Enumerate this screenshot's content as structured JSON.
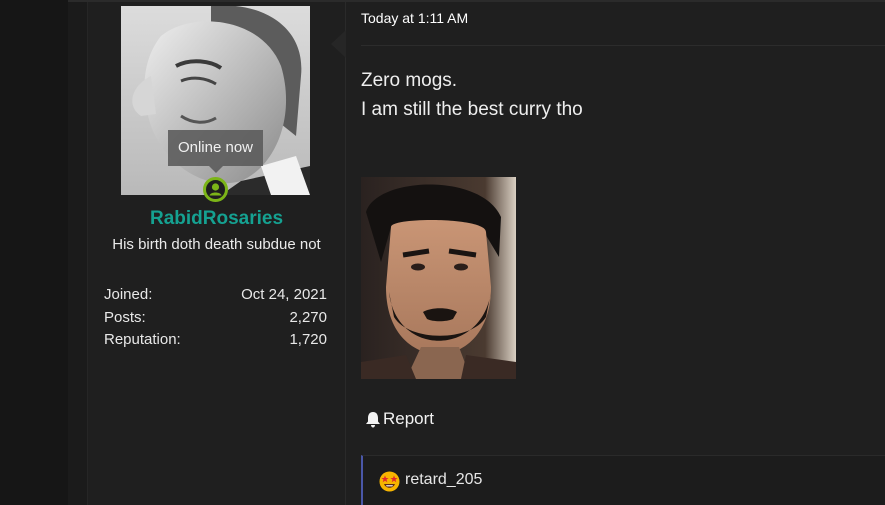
{
  "user": {
    "online_tooltip": "Online now",
    "username": "RabidRosaries",
    "title": "His birth doth death subdue not",
    "stats": [
      {
        "label": "Joined:",
        "value": "Oct 24, 2021"
      },
      {
        "label": "Posts:",
        "value": "2,270"
      },
      {
        "label": "Reputation:",
        "value": "1,720"
      }
    ]
  },
  "post": {
    "timestamp": "Today at 1:11 AM",
    "lines": [
      "Zero mogs.",
      "I am still the best curry tho"
    ],
    "report_label": "Report",
    "reaction_user": "retard_205"
  },
  "colors": {
    "username": "#15a191",
    "online": "#7cb518",
    "reaction_border": "#4a57a8"
  }
}
